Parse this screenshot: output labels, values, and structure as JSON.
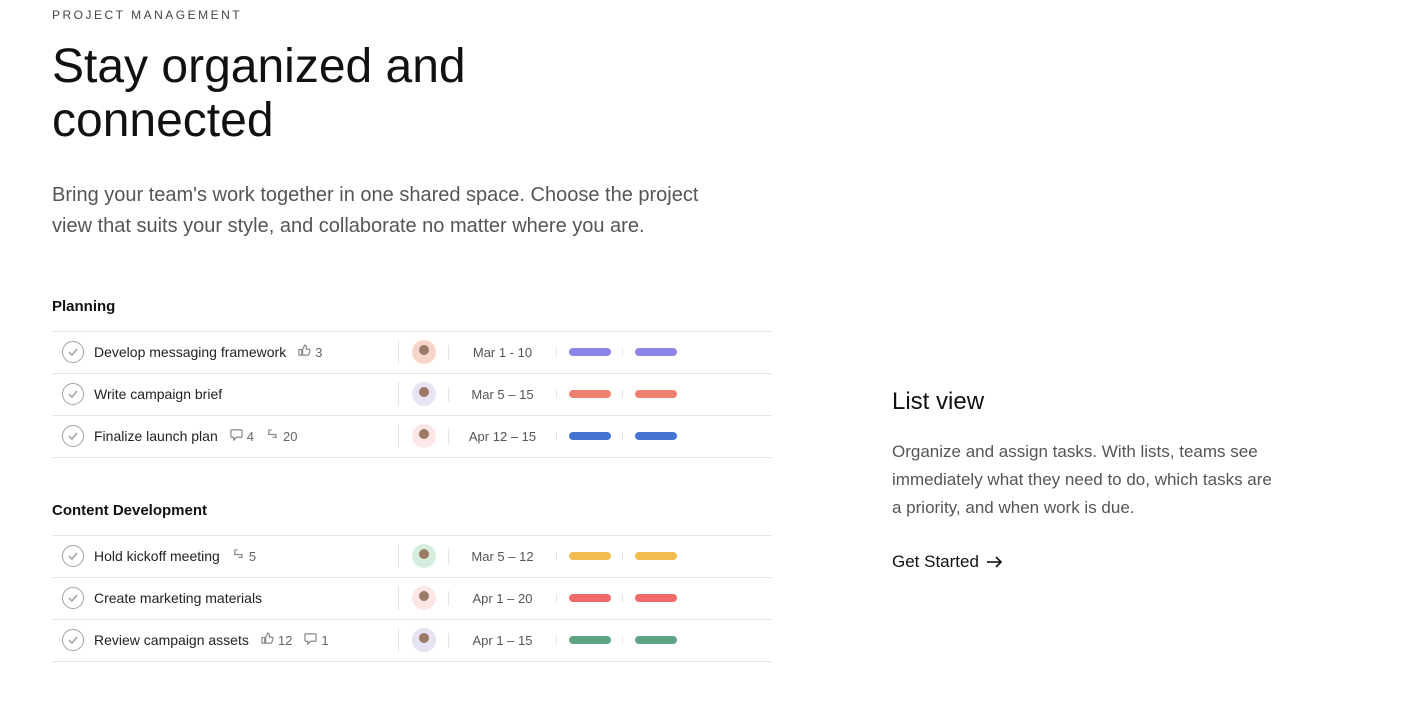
{
  "eyebrow": "PROJECT MANAGEMENT",
  "title": "Stay organized and connected",
  "subtitle": "Bring your team's work together in one shared space. Choose the project view that suits your style, and collaborate no matter where you are.",
  "sections": [
    {
      "name": "Planning",
      "tasks": [
        {
          "title": "Develop messaging framework",
          "likes": "3",
          "comments": "",
          "subtasks": "",
          "date": "Mar 1 - 10",
          "pill": "c-purple",
          "avatar": "av-1"
        },
        {
          "title": "Write campaign brief",
          "likes": "",
          "comments": "",
          "subtasks": "",
          "date": "Mar 5 – 15",
          "pill": "c-coral",
          "avatar": "av-2"
        },
        {
          "title": "Finalize launch plan",
          "likes": "",
          "comments": "4",
          "subtasks": "20",
          "date": "Apr 12 – 15",
          "pill": "c-blue",
          "avatar": "av-3"
        }
      ]
    },
    {
      "name": "Content Development",
      "tasks": [
        {
          "title": "Hold kickoff meeting",
          "likes": "",
          "comments": "",
          "subtasks": "5",
          "date": "Mar 5 – 12",
          "pill": "c-yellow",
          "avatar": "av-4"
        },
        {
          "title": "Create marketing materials",
          "likes": "",
          "comments": "",
          "subtasks": "",
          "date": "Apr 1 – 20",
          "pill": "c-red",
          "avatar": "av-3"
        },
        {
          "title": "Review campaign assets",
          "likes": "12",
          "comments": "1",
          "subtasks": "",
          "date": "Apr 1 – 15",
          "pill": "c-green",
          "avatar": "av-2"
        }
      ]
    }
  ],
  "side": {
    "title": "List view",
    "desc": "Organize and assign tasks. With lists, teams see immediately what they need to do, which tasks are a priority, and when work is due.",
    "cta": "Get Started"
  }
}
